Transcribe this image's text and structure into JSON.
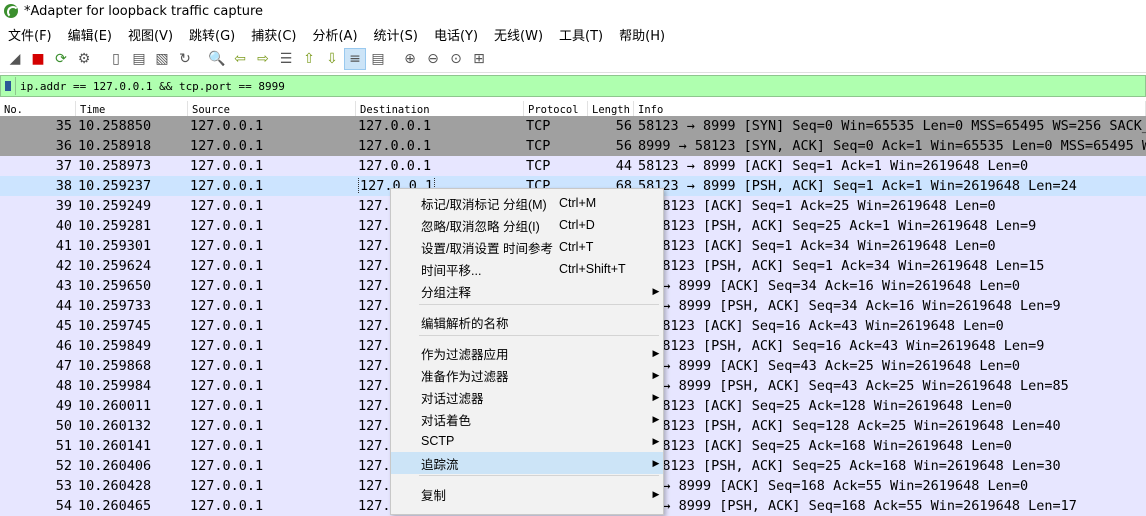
{
  "window": {
    "title": "*Adapter for loopback traffic capture"
  },
  "menubar": [
    "文件(F)",
    "编辑(E)",
    "视图(V)",
    "跳转(G)",
    "捕获(C)",
    "分析(A)",
    "统计(S)",
    "电话(Y)",
    "无线(W)",
    "工具(T)",
    "帮助(H)"
  ],
  "toolbar": [
    {
      "name": "shark-fin-start-icon",
      "glyph": "◢"
    },
    {
      "name": "stop-capture-icon",
      "glyph": "■"
    },
    {
      "name": "restart-capture-icon",
      "glyph": "⟳"
    },
    {
      "name": "capture-options-icon",
      "glyph": "⚙"
    },
    {
      "name": "open-file-icon",
      "glyph": "▯"
    },
    {
      "name": "save-file-icon",
      "glyph": "▤"
    },
    {
      "name": "close-file-icon",
      "glyph": "▧"
    },
    {
      "name": "reload-file-icon",
      "glyph": "↻"
    },
    {
      "name": "find-packet-icon",
      "glyph": "🔍"
    },
    {
      "name": "go-back-icon",
      "glyph": "⇦"
    },
    {
      "name": "go-forward-icon",
      "glyph": "⇨"
    },
    {
      "name": "go-to-packet-icon",
      "glyph": "☰"
    },
    {
      "name": "go-first-icon",
      "glyph": "⇧"
    },
    {
      "name": "go-last-icon",
      "glyph": "⇩"
    },
    {
      "name": "auto-scroll-icon",
      "glyph": "≡"
    },
    {
      "name": "colorize-icon",
      "glyph": "▤"
    },
    {
      "name": "zoom-in-icon",
      "glyph": "⊕"
    },
    {
      "name": "zoom-out-icon",
      "glyph": "⊖"
    },
    {
      "name": "zoom-normal-icon",
      "glyph": "⊙"
    },
    {
      "name": "resize-columns-icon",
      "glyph": "⊞"
    }
  ],
  "filter": {
    "value": "ip.addr == 127.0.0.1 && tcp.port == 8999"
  },
  "columns": [
    "No.",
    "Time",
    "Source",
    "Destination",
    "Protocol",
    "Length",
    "Info"
  ],
  "packets": [
    {
      "no": "35",
      "time": "10.258850",
      "src": "127.0.0.1",
      "dst": "127.0.0.1",
      "proto": "TCP",
      "len": "56",
      "info": "58123 → 8999 [SYN] Seq=0 Win=65535 Len=0 MSS=65495 WS=256 SACK_P",
      "style": "syn"
    },
    {
      "no": "36",
      "time": "10.258918",
      "src": "127.0.0.1",
      "dst": "127.0.0.1",
      "proto": "TCP",
      "len": "56",
      "info": "8999 → 58123 [SYN, ACK] Seq=0 Ack=1 Win=65535 Len=0 MSS=65495 WS",
      "style": "syn"
    },
    {
      "no": "37",
      "time": "10.258973",
      "src": "127.0.0.1",
      "dst": "127.0.0.1",
      "proto": "TCP",
      "len": "44",
      "info": "58123 → 8999 [ACK] Seq=1 Ack=1 Win=2619648 Len=0",
      "style": "norm"
    },
    {
      "no": "38",
      "time": "10.259237",
      "src": "127.0.0.1",
      "dst": "127.0.0.1",
      "proto": "TCP",
      "len": "68",
      "info": "58123 → 8999 [PSH, ACK] Seq=1 Ack=1 Win=2619648 Len=24",
      "style": "sel"
    },
    {
      "no": "39",
      "time": "10.259249",
      "src": "127.0.0.1",
      "dst": "127.",
      "proto": "",
      "len": "",
      "info": "  → 58123 [ACK] Seq=1 Ack=25 Win=2619648 Len=0",
      "style": "norm"
    },
    {
      "no": "40",
      "time": "10.259281",
      "src": "127.0.0.1",
      "dst": "127.",
      "proto": "",
      "len": "",
      "info": "  → 58123 [PSH, ACK] Seq=25 Ack=1 Win=2619648 Len=9",
      "style": "norm"
    },
    {
      "no": "41",
      "time": "10.259301",
      "src": "127.0.0.1",
      "dst": "127.",
      "proto": "",
      "len": "",
      "info": "  → 58123 [ACK] Seq=1 Ack=34 Win=2619648 Len=0",
      "style": "norm"
    },
    {
      "no": "42",
      "time": "10.259624",
      "src": "127.0.0.1",
      "dst": "127.",
      "proto": "",
      "len": "",
      "info": "  → 58123 [PSH, ACK] Seq=1 Ack=34 Win=2619648 Len=15",
      "style": "norm"
    },
    {
      "no": "43",
      "time": "10.259650",
      "src": "127.0.0.1",
      "dst": "127.",
      "proto": "",
      "len": "",
      "info": "23 → 8999 [ACK] Seq=34 Ack=16 Win=2619648 Len=0",
      "style": "norm"
    },
    {
      "no": "44",
      "time": "10.259733",
      "src": "127.0.0.1",
      "dst": "127.",
      "proto": "",
      "len": "",
      "info": "23 → 8999 [PSH, ACK] Seq=34 Ack=16 Win=2619648 Len=9",
      "style": "norm"
    },
    {
      "no": "45",
      "time": "10.259745",
      "src": "127.0.0.1",
      "dst": "127.",
      "proto": "",
      "len": "",
      "info": "  → 58123 [ACK] Seq=16 Ack=43 Win=2619648 Len=0",
      "style": "norm"
    },
    {
      "no": "46",
      "time": "10.259849",
      "src": "127.0.0.1",
      "dst": "127.",
      "proto": "",
      "len": "",
      "info": "  → 58123 [PSH, ACK] Seq=16 Ack=43 Win=2619648 Len=9",
      "style": "norm"
    },
    {
      "no": "47",
      "time": "10.259868",
      "src": "127.0.0.1",
      "dst": "127.",
      "proto": "",
      "len": "",
      "info": "23 → 8999 [ACK] Seq=43 Ack=25 Win=2619648 Len=0",
      "style": "norm"
    },
    {
      "no": "48",
      "time": "10.259984",
      "src": "127.0.0.1",
      "dst": "127.",
      "proto": "",
      "len": "",
      "info": "23 → 8999 [PSH, ACK] Seq=43 Ack=25 Win=2619648 Len=85",
      "style": "norm"
    },
    {
      "no": "49",
      "time": "10.260011",
      "src": "127.0.0.1",
      "dst": "127.",
      "proto": "",
      "len": "",
      "info": "  → 58123 [ACK] Seq=25 Ack=128 Win=2619648 Len=0",
      "style": "norm"
    },
    {
      "no": "50",
      "time": "10.260132",
      "src": "127.0.0.1",
      "dst": "127.",
      "proto": "",
      "len": "",
      "info": "  → 58123 [PSH, ACK] Seq=128 Ack=25 Win=2619648 Len=40",
      "style": "norm"
    },
    {
      "no": "51",
      "time": "10.260141",
      "src": "127.0.0.1",
      "dst": "127.",
      "proto": "",
      "len": "",
      "info": "  → 58123 [ACK] Seq=25 Ack=168 Win=2619648 Len=0",
      "style": "norm"
    },
    {
      "no": "52",
      "time": "10.260406",
      "src": "127.0.0.1",
      "dst": "127.",
      "proto": "",
      "len": "",
      "info": "  → 58123 [PSH, ACK] Seq=25 Ack=168 Win=2619648 Len=30",
      "style": "norm"
    },
    {
      "no": "53",
      "time": "10.260428",
      "src": "127.0.0.1",
      "dst": "127.",
      "proto": "",
      "len": "",
      "info": "23 → 8999 [ACK] Seq=168 Ack=55 Win=2619648 Len=0",
      "style": "norm"
    },
    {
      "no": "54",
      "time": "10.260465",
      "src": "127.0.0.1",
      "dst": "127.",
      "proto": "",
      "len": "",
      "info": "23 → 8999 [PSH, ACK] Seq=168 Ack=55 Win=2619648 Len=17",
      "style": "norm"
    }
  ],
  "context_menu": [
    {
      "label": "标记/取消标记 分组(M)",
      "shortcut": "Ctrl+M",
      "submenu": false
    },
    {
      "label": "忽略/取消忽略 分组(I)",
      "shortcut": "Ctrl+D",
      "submenu": false
    },
    {
      "label": "设置/取消设置 时间参考",
      "shortcut": "Ctrl+T",
      "submenu": false
    },
    {
      "label": "时间平移...",
      "shortcut": "Ctrl+Shift+T",
      "submenu": false
    },
    {
      "label": "分组注释",
      "shortcut": "",
      "submenu": true
    },
    {
      "label": "编辑解析的名称",
      "shortcut": "",
      "submenu": false
    },
    {
      "label": "作为过滤器应用",
      "shortcut": "",
      "submenu": true
    },
    {
      "label": "准备作为过滤器",
      "shortcut": "",
      "submenu": true
    },
    {
      "label": "对话过滤器",
      "shortcut": "",
      "submenu": true
    },
    {
      "label": "对话着色",
      "shortcut": "",
      "submenu": true
    },
    {
      "label": "SCTP",
      "shortcut": "",
      "submenu": true
    },
    {
      "label": "追踪流",
      "shortcut": "",
      "submenu": true,
      "highlighted": true
    },
    {
      "label": "复制",
      "shortcut": "",
      "submenu": true
    }
  ],
  "colors": {
    "syn_row": "#a0a0a0",
    "normal_row": "#e7e6ff",
    "selected_row": "#cce4ff",
    "filter_bg": "#afffaf",
    "menu_highlight": "#cce4f7"
  }
}
